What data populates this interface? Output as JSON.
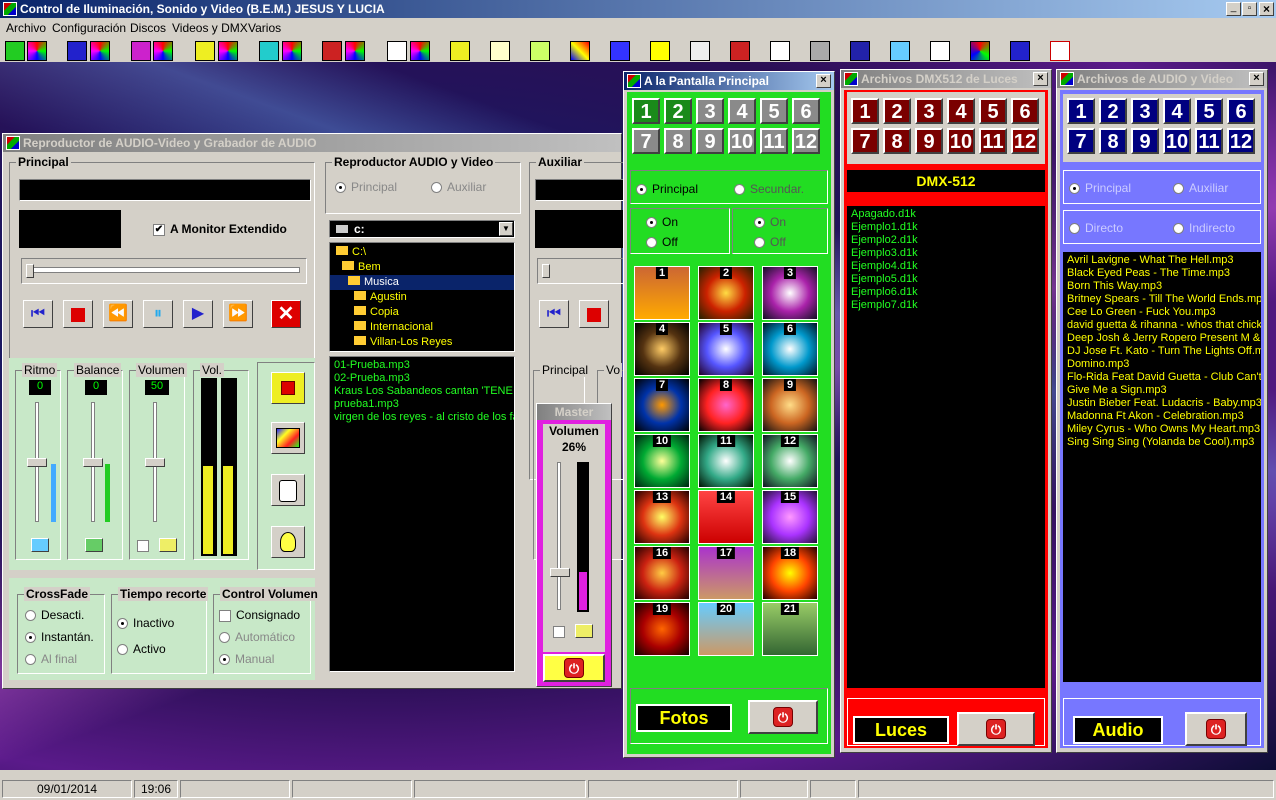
{
  "app": {
    "title": "Control de Iluminación, Sonido y Video (B.E.M.)  JESUS Y LUCIA",
    "min": "_",
    "max": "▫",
    "close": "×"
  },
  "menu": [
    "Archivo",
    "Configuración",
    "Discos",
    "Videos y DMX",
    "Varios"
  ],
  "player": {
    "title": "Reproductor de AUDIO-Video y Grabador de AUDIO",
    "principal_label": "Principal",
    "monitor_label": "A Monitor Extendido",
    "reproductor_label": "Reproductor AUDIO y Video",
    "radio_principal": "Principal",
    "radio_auxiliar": "Auxiliar",
    "drive": "c:",
    "folders": [
      "C:\\",
      "Bem",
      "Musica",
      "Agustin",
      "Copia",
      "Internacional",
      "Villan-Los Reyes"
    ],
    "files": [
      "01-Prueba.mp3",
      "02-Prueba.mp3",
      "Kraus  Los Sabandeos cantan 'TENE",
      "prueba1.mp3",
      "virgen de los reyes - al cristo de los fa"
    ],
    "ritmo": {
      "label": "Ritmo",
      "value": "0"
    },
    "balance": {
      "label": "Balance",
      "value": "0"
    },
    "volumen": {
      "label": "Volumen",
      "value": "50"
    },
    "vol_label": "Vol.",
    "crossfade": {
      "label": "CrossFade",
      "options": [
        "Desacti.",
        "Instantán.",
        "Al final"
      ]
    },
    "tiempo": {
      "label": "Tiempo recorte",
      "options": [
        "Inactivo",
        "Activo"
      ]
    },
    "control": {
      "label": "Control Volumen",
      "options": [
        "Consignado",
        "Automático",
        "Manual"
      ]
    },
    "auxiliar_label": "Auxiliar",
    "aux_principal_label": "Principal",
    "aux_vol_label": "Vo"
  },
  "master": {
    "title": "Master",
    "vol_label": "Volumen",
    "vol_value": "26%",
    "level": 0.26
  },
  "pantalla": {
    "title": "A la Pantalla Principal",
    "buttons": [
      "1",
      "2",
      "3",
      "4",
      "5",
      "6",
      "7",
      "8",
      "9",
      "10",
      "11",
      "12"
    ],
    "radio_principal": "Principal",
    "radio_secundar": "Secundar.",
    "on": "On",
    "off": "Off",
    "thumbs": [
      "1",
      "2",
      "3",
      "4",
      "5",
      "6",
      "7",
      "8",
      "9",
      "10",
      "11",
      "12",
      "13",
      "14",
      "15",
      "16",
      "17",
      "18",
      "19",
      "20",
      "21"
    ],
    "footer": "Fotos"
  },
  "dmx": {
    "title": "Archivos DMX512 de Luces",
    "buttons": [
      "1",
      "2",
      "3",
      "4",
      "5",
      "6",
      "7",
      "8",
      "9",
      "10",
      "11",
      "12"
    ],
    "header": "DMX-512",
    "files": [
      "Apagado.d1k",
      "Ejemplo1.d1k",
      "Ejemplo2.d1k",
      "Ejemplo3.d1k",
      "Ejemplo4.d1k",
      "Ejemplo5.d1k",
      "Ejemplo6.d1k",
      "Ejemplo7.d1k"
    ],
    "footer": "Luces"
  },
  "audio": {
    "title": "Archivos de AUDIO y Video",
    "buttons": [
      "1",
      "2",
      "3",
      "4",
      "5",
      "6",
      "7",
      "8",
      "9",
      "10",
      "11",
      "12"
    ],
    "radio_principal": "Principal",
    "radio_auxiliar": "Auxiliar",
    "radio_directo": "Directo",
    "radio_indirecto": "Indirecto",
    "files": [
      "Avril Lavigne - What The Hell.mp3",
      "Black Eyed Peas - The Time.mp3",
      "Born This Way.mp3",
      "Britney Spears - Till The World Ends.mp3",
      "Cee Lo Green - Fuck You.mp3",
      "david guetta & rihanna - whos that chick.m",
      "Deep Josh & Jerry Ropero Present M & M",
      "DJ Jose Ft. Kato - Turn The Lights Off.mp",
      "Domino.mp3",
      "Flo-Rida Feat David Guetta - Club Can't H",
      "Give Me a Sign.mp3",
      "Justin Bieber Feat. Ludacris - Baby.mp3",
      "Madonna Ft Akon - Celebration.mp3",
      "Miley Cyrus - Who Owns My Heart.mp3",
      "Sing Sing Sing (Yolanda be Cool).mp3"
    ],
    "footer": "Audio"
  },
  "status": {
    "date": "09/01/2014",
    "time": "19:06"
  },
  "colors": {
    "green": "#22dd22",
    "red": "#ff0000",
    "blue": "#7777ff",
    "dkred": "#7a0000",
    "navy": "#000080"
  }
}
